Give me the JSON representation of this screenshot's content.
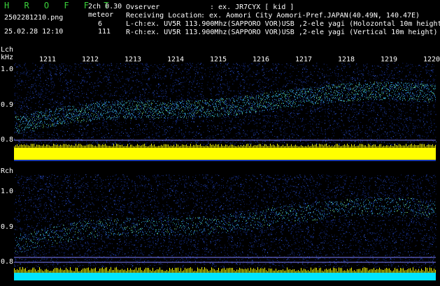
{
  "header": {
    "logo": "H R O F F T",
    "filename": "2502281210.png",
    "datetime": "25.02.28 12:10",
    "mode": "2ch 0.30",
    "meteor_label": "meteor",
    "meteor_l": "6",
    "meteor_r": "111",
    "observer_label": "Ovserver",
    "observer_value": ": ex. JR7CYX [ kid ]",
    "location_label": "Receiving Location",
    "location_value": ": ex. Aomori City Aomori-Pref.JAPAN(40.49N, 140.47E)",
    "lch_line": "L-ch:ex. UV5R 113.900Mhz(SAPPORO VOR)USB ,2-ele yagi (Holozontal 10m height)",
    "rch_line": "R-ch:ex. UV5R 113.900Mhz(SAPPORO VOR)USB ,2-ele yagi (Vertical 10m height)"
  },
  "lch": {
    "label": "Lch",
    "unit": "kHz",
    "yticks": [
      "1.0",
      "0.9",
      "0.8"
    ]
  },
  "rch": {
    "label": "Rch",
    "yticks": [
      "1.0",
      "0.9",
      "0.8"
    ]
  },
  "time_ticks": [
    "1211",
    "1212",
    "1213",
    "1214",
    "1215",
    "1216",
    "1217",
    "1218",
    "1219",
    "1220"
  ],
  "colors": {
    "background": "#000000",
    "logo": "#3bd13b",
    "noise": "#1a3aa8",
    "signal": "#38c0c0",
    "yellow_bar": "#ffff00",
    "cyan_bar": "#00e5ff"
  }
}
